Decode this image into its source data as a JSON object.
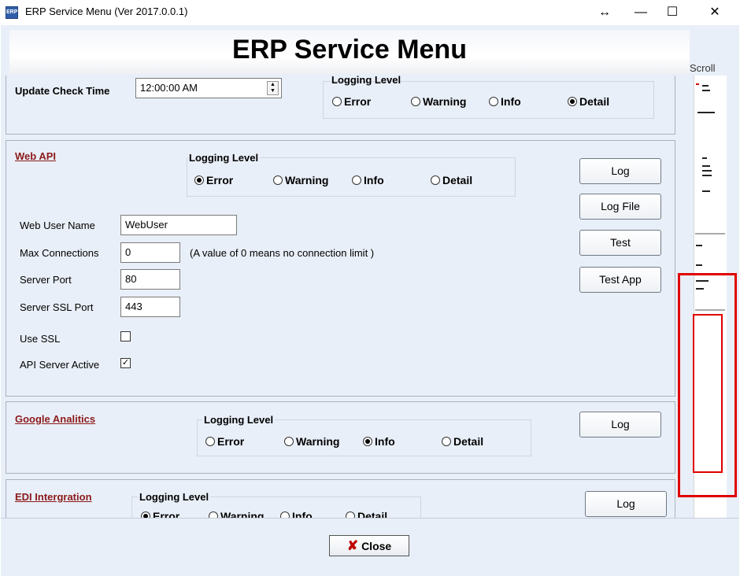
{
  "window": {
    "icon_text": "ERP",
    "title": "ERP Service Menu (Ver 2017.0.0.1)",
    "restore_glyph": "↔",
    "minimize_glyph": "—",
    "maximize_glyph": "☐",
    "close_glyph": "✕"
  },
  "banner": {
    "title": "ERP Service Menu"
  },
  "scroll": {
    "label": "Scroll"
  },
  "top_panel": {
    "update_check_label": "Update Check Time",
    "update_check_value": "12:00:00 AM",
    "logging_level_label": "Logging Level",
    "levels": [
      "Error",
      "Warning",
      "Info",
      "Detail"
    ],
    "selected": "Detail"
  },
  "web_api": {
    "title": "Web API",
    "logging_level_label": "Logging Level",
    "levels": [
      "Error",
      "Warning",
      "Info",
      "Detail"
    ],
    "selected": "Error",
    "buttons": {
      "log": "Log",
      "log_file": "Log File",
      "test": "Test",
      "test_app": "Test App"
    },
    "fields": {
      "web_user_name_label": "Web User Name",
      "web_user_name_value": "WebUser",
      "max_connections_label": "Max Connections",
      "max_connections_value": "0",
      "max_connections_note": "(A value of 0 means no connection limit )",
      "server_port_label": "Server Port",
      "server_port_value": "80",
      "server_ssl_port_label": "Server SSL Port",
      "server_ssl_port_value": "443",
      "use_ssl_label": "Use SSL",
      "use_ssl_checked": false,
      "api_server_active_label": "API Server Active",
      "api_server_active_checked": true
    }
  },
  "google": {
    "title": "Google Analitics",
    "logging_level_label": "Logging Level",
    "levels": [
      "Error",
      "Warning",
      "Info",
      "Detail"
    ],
    "selected": "Info",
    "buttons": {
      "log": "Log"
    }
  },
  "edi": {
    "title": "EDI Intergration",
    "logging_level_label": "Logging Level",
    "levels": [
      "Error",
      "Warning",
      "Info",
      "Detail"
    ],
    "selected": "Error",
    "buttons": {
      "log": "Log"
    }
  },
  "footer": {
    "close_label": "Close",
    "close_glyph": "✘"
  },
  "colors": {
    "highlight": "#e00000",
    "section_title": "#8b1a1a",
    "background": "#e9eff8"
  }
}
